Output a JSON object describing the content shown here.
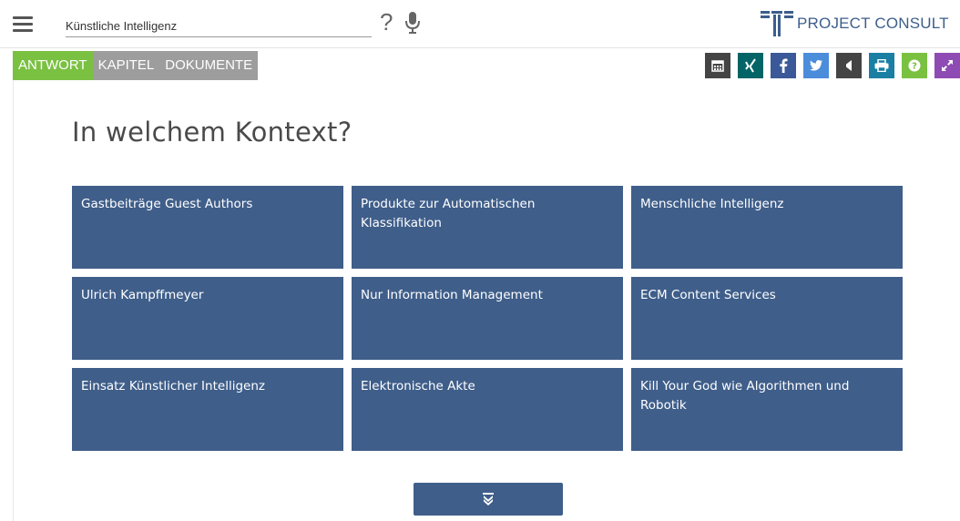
{
  "header": {
    "search": {
      "value": "Künstliche Intelligenz",
      "placeholder": ""
    },
    "help_label": "?",
    "logo_text": "PROJECT CONSULT"
  },
  "tabs": [
    {
      "label": "ANTWORT",
      "active": true
    },
    {
      "label": "KAPITEL",
      "active": false
    },
    {
      "label": "DOKUMENTE",
      "active": false
    }
  ],
  "share_buttons": [
    {
      "icon": "calendar-icon",
      "color": "#444444"
    },
    {
      "icon": "xing-icon",
      "color": "#026466"
    },
    {
      "icon": "facebook-icon",
      "color": "#3b5998"
    },
    {
      "icon": "twitter-icon",
      "color": "#4c8ddb"
    },
    {
      "icon": "speaker-icon",
      "color": "#444444"
    },
    {
      "icon": "print-icon",
      "color": "#1a7fa3"
    },
    {
      "icon": "question-icon",
      "color": "#7ac142"
    },
    {
      "icon": "expand-icon",
      "color": "#8e4bb3"
    }
  ],
  "main": {
    "heading": "In welchem Kontext?",
    "cards": [
      "Gastbeiträge Guest Authors",
      "Produkte zur Automatischen Klassifikation",
      "Menschliche Intelligenz",
      "Ulrich Kampffmeyer",
      "Nur Information Management",
      "ECM Content Services",
      "Einsatz Künstlicher Intelligenz",
      "Elektronische Akte",
      "Kill Your God wie Algorithmen und Robotik"
    ],
    "more_icon": "double-chevron-down-icon"
  },
  "colors": {
    "card_bg": "#3f5e8a",
    "tab_active": "#7ac142",
    "tab_inactive": "#9d9d9d",
    "logo": "#3d5e8c"
  }
}
